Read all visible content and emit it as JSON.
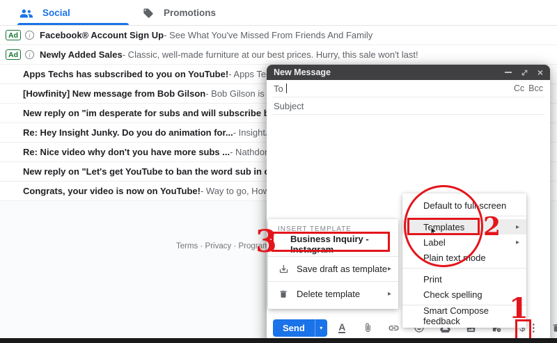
{
  "tab_bar": {
    "tabs": [
      {
        "label": "Social",
        "active": true
      },
      {
        "label": "Promotions",
        "active": false
      }
    ]
  },
  "ads": [
    {
      "badge": "Ad",
      "subject": "Facebook® Account Sign Up",
      "snippet": " - See What You've Missed From Friends And Family"
    },
    {
      "badge": "Ad",
      "subject": "Newly Added Sales",
      "snippet": " - Classic, well-made furniture at our best prices. Hurry, this sale won't last!"
    }
  ],
  "emails": [
    {
      "subject": "Apps Techs has subscribed to you on YouTube!",
      "snippet": " - Apps Techs has subscribed to"
    },
    {
      "subject": "[Howfinity] New message from Bob Gilson",
      "snippet": " - Bob Gilson is waiting for a respon"
    },
    {
      "subject": "New reply on \"im desperate for subs and will subscribe back to everyone til i h",
      "snippet": ""
    },
    {
      "subject": "Re: Hey Insight Junky. Do you do animation for...",
      "snippet": " - InsightJunky replied to you"
    },
    {
      "subject": "Re: Nice video why don't you have more subs ...",
      "snippet": " - Nathdon Playz replied to Nat"
    },
    {
      "subject": "New reply on \"Let's get YouTube to ban the word sub in comments. I hate seei",
      "snippet": ""
    },
    {
      "subject": "Congrats, your video is now on YouTube!",
      "snippet": " - Way to go, Howfinity! Your video is"
    }
  ],
  "footer": {
    "links": "Terms · Privacy · Program Policies"
  },
  "compose": {
    "title": "New Message",
    "to_label": "To",
    "cc_label": "Cc",
    "bcc_label": "Bcc",
    "subject_label": "Subject",
    "send_label": "Send"
  },
  "options_menu": {
    "items": [
      {
        "label": "Default to full-screen"
      },
      {
        "label": "Templates"
      },
      {
        "label": "Label"
      },
      {
        "label": "Plain text mode"
      },
      {
        "label": "Print"
      },
      {
        "label": "Check spelling"
      },
      {
        "label": "Smart Compose feedback"
      }
    ]
  },
  "template_menu": {
    "header": "INSERT TEMPLATE",
    "template_name": "Business Inquiry - Instagram",
    "items": [
      {
        "label": "Save draft as template"
      },
      {
        "label": "Delete template"
      }
    ]
  },
  "annotations": {
    "step1": "1",
    "step2": "2",
    "step3": "3"
  },
  "icons": {
    "more_options": "⋮",
    "dollar": "$",
    "submenu_arrow": "▸",
    "close": "×",
    "send_caret": "▾",
    "format_letter": "A"
  },
  "colors": {
    "accent_blue": "#1a73e8",
    "header_dark": "#404042",
    "ad_green": "#137333",
    "annotation_red": "#e3151c"
  }
}
